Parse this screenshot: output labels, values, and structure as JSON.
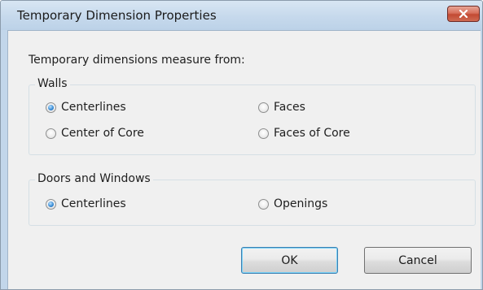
{
  "window": {
    "title": "Temporary Dimension Properties",
    "close_icon": "close-x"
  },
  "intro": "Temporary dimensions measure from:",
  "walls": {
    "legend": "Walls",
    "options": [
      {
        "label": "Centerlines",
        "checked": true
      },
      {
        "label": "Faces",
        "checked": false
      },
      {
        "label": "Center of Core",
        "checked": false
      },
      {
        "label": "Faces of Core",
        "checked": false
      }
    ]
  },
  "doors_windows": {
    "legend": "Doors and Windows",
    "options": [
      {
        "label": "Centerlines",
        "checked": true
      },
      {
        "label": "Openings",
        "checked": false
      }
    ]
  },
  "buttons": {
    "ok": "OK",
    "cancel": "Cancel"
  },
  "colors": {
    "titlebar": "#c6d9ec",
    "client_bg": "#f0f0f0",
    "close_button": "#c24a33",
    "radio_selected": "#3d8fd6"
  }
}
